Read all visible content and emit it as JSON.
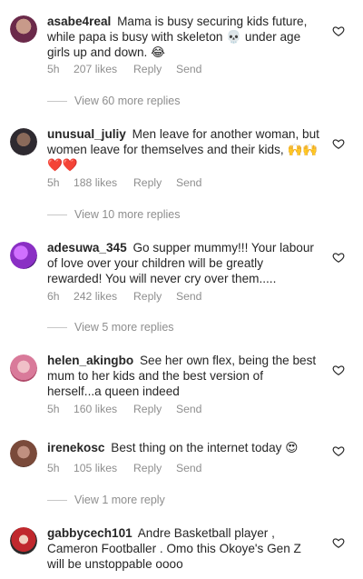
{
  "comments": [
    {
      "username": "asabe4real",
      "text": "Mama is busy securing kids future, while papa is busy with skeleton 💀  under age girls up and down. 😂",
      "time": "5h",
      "likes": "207 likes",
      "reply": "Reply",
      "send": "Send",
      "view_replies": "View 60 more replies",
      "avatar_color": "#6b2a4a"
    },
    {
      "username": "unusual_juliy",
      "text": "Men leave for another woman, but women leave for themselves and their kids, 🙌🙌❤️❤️",
      "time": "5h",
      "likes": "188 likes",
      "reply": "Reply",
      "send": "Send",
      "view_replies": "View 10 more replies",
      "avatar_color": "#2e2a30"
    },
    {
      "username": "adesuwa_345",
      "text": "Go supper mummy!!! Your labour of love over your children will be greatly rewarded! You will never cry over them.....",
      "time": "6h",
      "likes": "242 likes",
      "reply": "Reply",
      "send": "Send",
      "view_replies": "View 5 more replies",
      "avatar_color": "#8a2fc4"
    },
    {
      "username": "helen_akingbo",
      "text": "See her own flex, being the best mum to her kids and the best version of herself...a queen indeed",
      "time": "5h",
      "likes": "160 likes",
      "reply": "Reply",
      "send": "Send",
      "view_replies": "",
      "avatar_color": "#d97a9a"
    },
    {
      "username": "irenekosc",
      "text": "Best thing on the internet today 😍",
      "time": "5h",
      "likes": "105 likes",
      "reply": "Reply",
      "send": "Send",
      "view_replies": "View 1 more reply",
      "avatar_color": "#7a4a3a"
    },
    {
      "username": "gabbycech101",
      "text": "Andre Basketball player , Cameron Footballer . Omo this Okoye's Gen Z will be unstoppable oooo",
      "time": "",
      "likes": "",
      "reply": "",
      "send": "",
      "view_replies": "",
      "avatar_color": "#c0282d"
    }
  ],
  "icons": {
    "like": "heart-outline-icon"
  },
  "colors": {
    "text": "#262626",
    "muted": "#8e8e8e"
  }
}
